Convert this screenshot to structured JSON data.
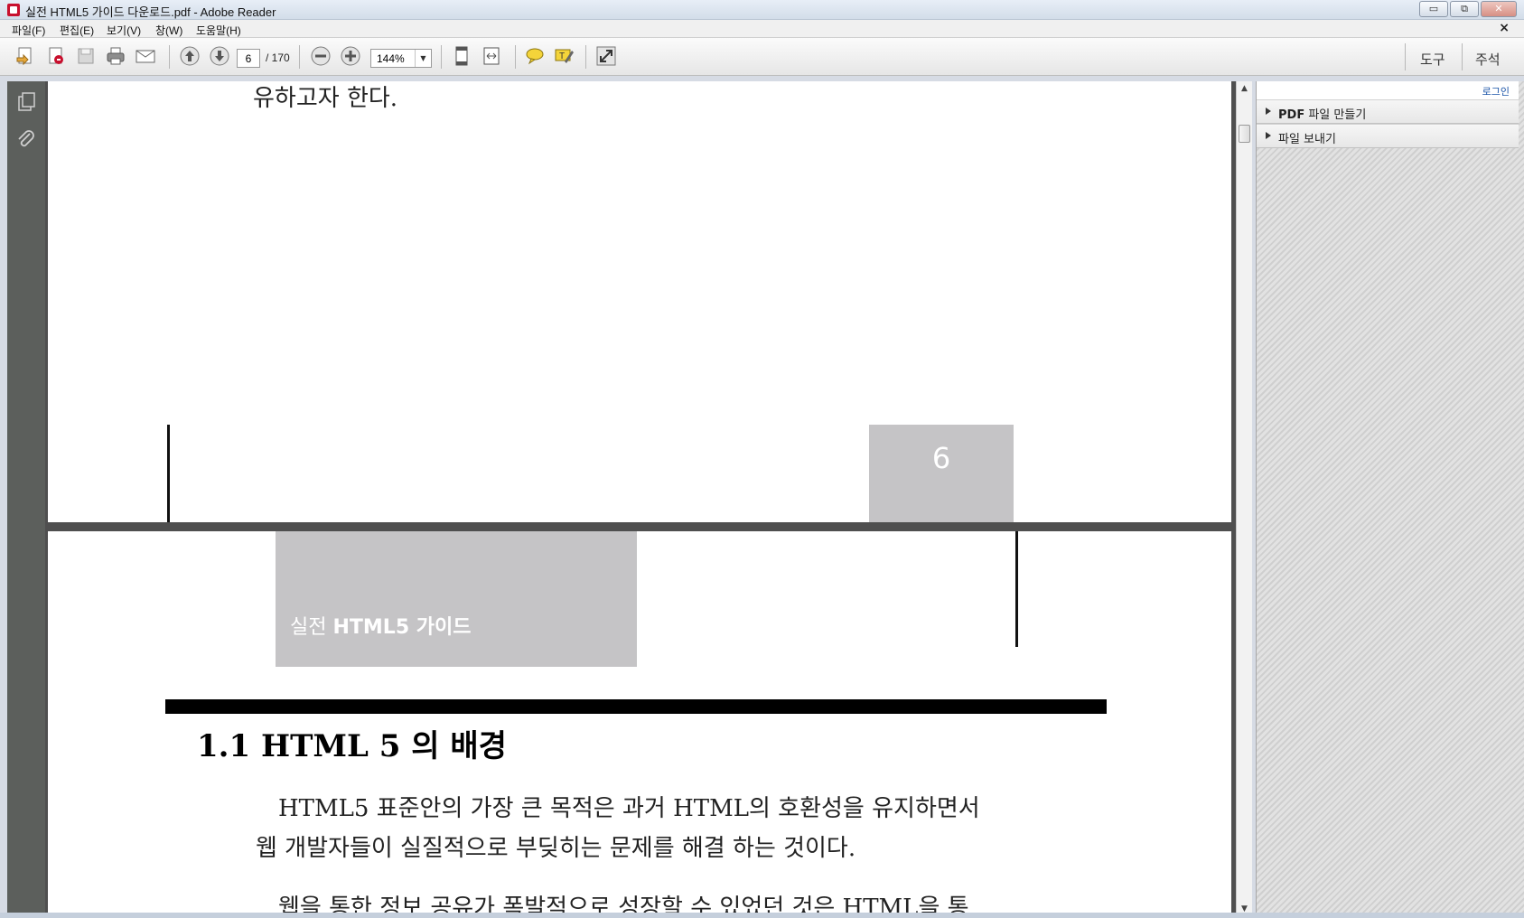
{
  "window": {
    "title": "실전 HTML5 가이드 다운로드.pdf - Adobe Reader",
    "minimize": "▭",
    "restore": "⧉",
    "close": "✕"
  },
  "menu": {
    "items": [
      "파일(F)",
      "편집(E)",
      "보기(V)",
      "창(W)",
      "도움말(H)"
    ],
    "doc_close": "×"
  },
  "toolbar": {
    "current_page": "6",
    "total_pages": "/ 170",
    "zoom": "144%",
    "tools_label": "도구",
    "comment_label": "주석",
    "icons": [
      "create-pdf-icon",
      "convert-icon",
      "save-icon",
      "print-icon",
      "email-icon",
      "page-up-icon",
      "page-down-icon",
      "zoom-out-icon",
      "zoom-in-icon",
      "fit-page-icon",
      "fit-width-icon",
      "comment-icon",
      "highlight-icon",
      "full-screen-icon"
    ]
  },
  "leftnav": {
    "icons": [
      "pages-icon",
      "attachment-icon"
    ]
  },
  "document": {
    "page1_text": "유하고자 한다.",
    "page_number": "6",
    "book_title_prefix": "실전",
    "book_title_bold": "HTML5 가이드",
    "section_heading": "1.1 HTML 5 의 배경",
    "para1_line1": "HTML5 표준안의 가장 큰 목적은 과거 HTML의 호환성을 유지하면서",
    "para1_line2": "웹 개발자들이 실질적으로 부딪히는 문제를 해결 하는 것이다.",
    "para2_line1": "웹을 통한 정보 공유가 폭발적으로 성장할 수 있었던 것은 HTML을 통"
  },
  "rightpane": {
    "login": "로그인",
    "items": [
      {
        "bold": "PDF",
        "label": "파일 만들기"
      },
      {
        "bold": "",
        "label": "파일 보내기"
      }
    ]
  }
}
